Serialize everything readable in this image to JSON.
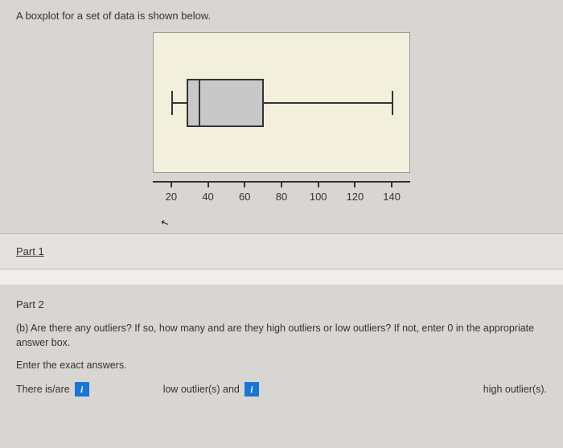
{
  "intro": "A boxplot for a set of data is shown below.",
  "chart_data": {
    "type": "boxplot",
    "xlabel": "",
    "ylabel": "",
    "xlim": [
      10,
      150
    ],
    "ticks": [
      20,
      40,
      60,
      80,
      100,
      120,
      140
    ],
    "min": 20,
    "q1": 28,
    "median": 35,
    "q3": 70,
    "max": 140
  },
  "part1": {
    "label": "Part 1"
  },
  "part2": {
    "label": "Part 2",
    "question": "(b) Are there any outliers? If so, how many and are they high outliers or low outliers? If not, enter 0 in the appropriate answer box.",
    "instruction": "Enter the exact answers.",
    "lead": "There is/are",
    "mid": "low outlier(s) and",
    "trail": "high outlier(s)."
  }
}
